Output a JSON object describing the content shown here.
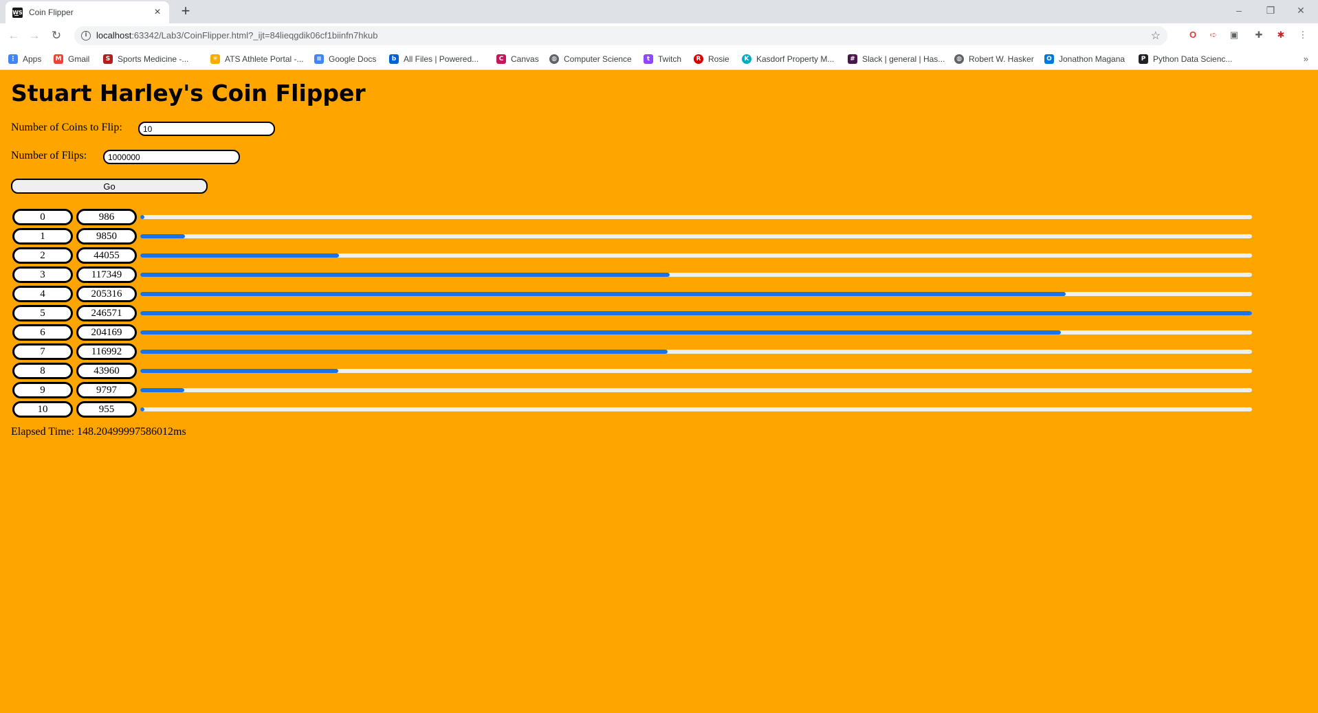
{
  "browser": {
    "tab": {
      "title": "Coin Flipper",
      "favicon": "WS"
    },
    "url": {
      "host": "localhost",
      "rest": ":63342/Lab3/CoinFlipper.html?_ijt=84lieqgdik06cf1biinfn7hkub"
    },
    "window_controls": {
      "minimize": "–",
      "restore": "❐",
      "close": "✕"
    },
    "bookmarks": [
      {
        "label": "Apps",
        "icon": "apps-grid-icon",
        "color": "#4285f4"
      },
      {
        "label": "Gmail",
        "icon": "gmail-icon",
        "color": "#ea4335"
      },
      {
        "label": "Sports Medicine -...",
        "icon": "sports-medicine-icon",
        "color": "#b71c1c"
      },
      {
        "label": "ATS Athlete Portal -...",
        "icon": "ats-icon",
        "color": "#f9ab00"
      },
      {
        "label": "Google Docs",
        "icon": "google-docs-icon",
        "color": "#4285f4"
      },
      {
        "label": "All Files | Powered...",
        "icon": "box-icon",
        "color": "#0061d5"
      },
      {
        "label": "Canvas",
        "icon": "canvas-icon",
        "color": "#c2185b"
      },
      {
        "label": "Computer Science",
        "icon": "globe-icon",
        "color": "#5f6368"
      },
      {
        "label": "Twitch",
        "icon": "twitch-icon",
        "color": "#9146ff"
      },
      {
        "label": "Rosie",
        "icon": "rosie-icon",
        "color": "#d50000"
      },
      {
        "label": "Kasdorf Property M...",
        "icon": "kasdorf-icon",
        "color": "#00acc1"
      },
      {
        "label": "Slack | general | Has...",
        "icon": "slack-icon",
        "color": "#4a154b"
      },
      {
        "label": "Robert W. Hasker",
        "icon": "globe-icon",
        "color": "#5f6368"
      },
      {
        "label": "Jonathon Magana",
        "icon": "outlook-icon",
        "color": "#0078d4"
      },
      {
        "label": "Python Data Scienc...",
        "icon": "python-ds-icon",
        "color": "#202124"
      }
    ]
  },
  "page": {
    "title": "Stuart Harley's Coin Flipper",
    "coins_label": "Number of Coins to Flip:",
    "coins_value": "10",
    "flips_label": "Number of Flips:",
    "flips_value": "1000000",
    "go_label": "Go",
    "elapsed_text": "Elapsed Time: 148.20499997586012ms",
    "bar_color": "#1a73e8",
    "max_count": 246571,
    "results": [
      {
        "coins": "0",
        "count": 986
      },
      {
        "coins": "1",
        "count": 9850
      },
      {
        "coins": "2",
        "count": 44055
      },
      {
        "coins": "3",
        "count": 117349
      },
      {
        "coins": "4",
        "count": 205316
      },
      {
        "coins": "5",
        "count": 246571
      },
      {
        "coins": "6",
        "count": 204169
      },
      {
        "coins": "7",
        "count": 116992
      },
      {
        "coins": "8",
        "count": 43960
      },
      {
        "coins": "9",
        "count": 9797
      },
      {
        "coins": "10",
        "count": 955
      }
    ]
  }
}
